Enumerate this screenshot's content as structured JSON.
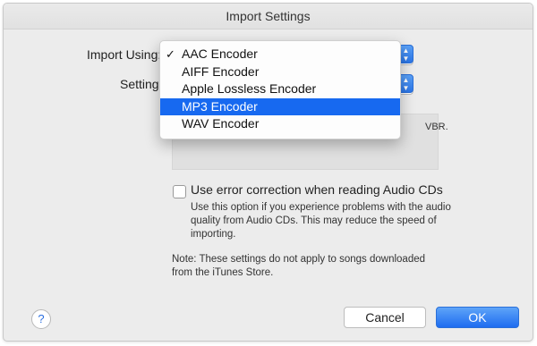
{
  "window": {
    "title": "Import Settings"
  },
  "import_using": {
    "label": "Import Using:"
  },
  "setting": {
    "label": "Setting:"
  },
  "encoder_menu": {
    "items": [
      {
        "label": "AAC Encoder",
        "checked": true,
        "selected": false
      },
      {
        "label": "AIFF Encoder",
        "checked": false,
        "selected": false
      },
      {
        "label": "Apple Lossless Encoder",
        "checked": false,
        "selected": false
      },
      {
        "label": "MP3 Encoder",
        "checked": false,
        "selected": true
      },
      {
        "label": "WAV Encoder",
        "checked": false,
        "selected": false
      }
    ],
    "check_glyph": "✓"
  },
  "details": {
    "text": "VBR."
  },
  "error_correction": {
    "label": "Use error correction when reading Audio CDs",
    "checked": false,
    "help": "Use this option if you experience problems with the audio quality from Audio CDs.  This may reduce the speed of importing."
  },
  "note": "Note: These settings do not apply to songs downloaded from the iTunes Store.",
  "buttons": {
    "help_glyph": "?",
    "cancel": "Cancel",
    "ok": "OK"
  },
  "colors": {
    "accent": "#1769f0",
    "window_bg": "#ececec"
  }
}
